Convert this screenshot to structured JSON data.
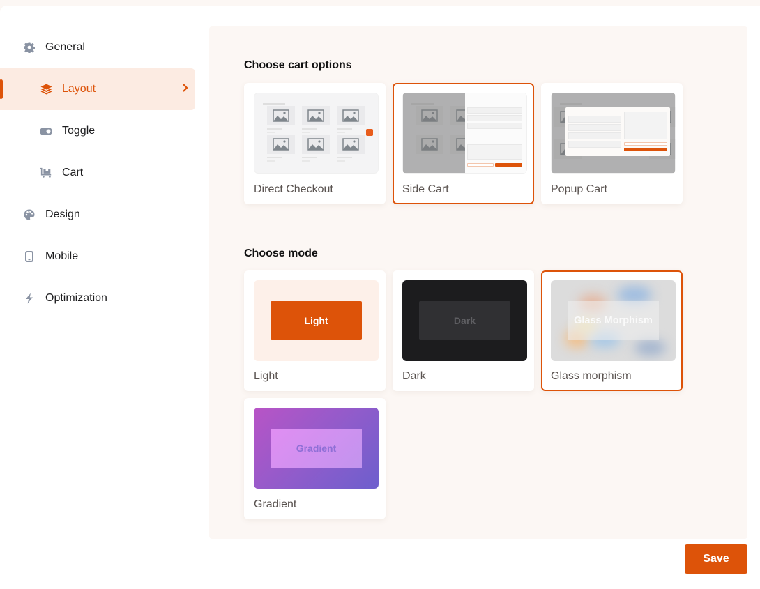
{
  "sidebar": {
    "items": [
      {
        "label": "General",
        "icon": "gear-icon",
        "level": 0
      },
      {
        "label": "Layout",
        "icon": "layers-icon",
        "level": 1,
        "active": true
      },
      {
        "label": "Toggle",
        "icon": "toggle-icon",
        "level": 1
      },
      {
        "label": "Cart",
        "icon": "cart-icon",
        "level": 1
      },
      {
        "label": "Design",
        "icon": "palette-icon",
        "level": 0
      },
      {
        "label": "Mobile",
        "icon": "mobile-icon",
        "level": 0
      },
      {
        "label": "Optimization",
        "icon": "bolt-icon",
        "level": 0
      }
    ]
  },
  "cart_options": {
    "title": "Choose cart options",
    "selected": "Side Cart",
    "options": [
      {
        "label": "Direct Checkout"
      },
      {
        "label": "Side Cart"
      },
      {
        "label": "Popup Cart"
      }
    ]
  },
  "mode": {
    "title": "Choose mode",
    "selected": "Glass morphism",
    "options": [
      {
        "label": "Light",
        "preview_text": "Light"
      },
      {
        "label": "Dark",
        "preview_text": "Dark"
      },
      {
        "label": "Glass morphism",
        "preview_text": "Glass Morphism"
      },
      {
        "label": "Gradient",
        "preview_text": "Gradient"
      }
    ]
  },
  "footer": {
    "save_label": "Save"
  },
  "colors": {
    "accent": "#dd5309",
    "active_bg": "#fcebe2",
    "panel_bg": "#fcf7f4",
    "icon_gray": "#8a93a3"
  }
}
